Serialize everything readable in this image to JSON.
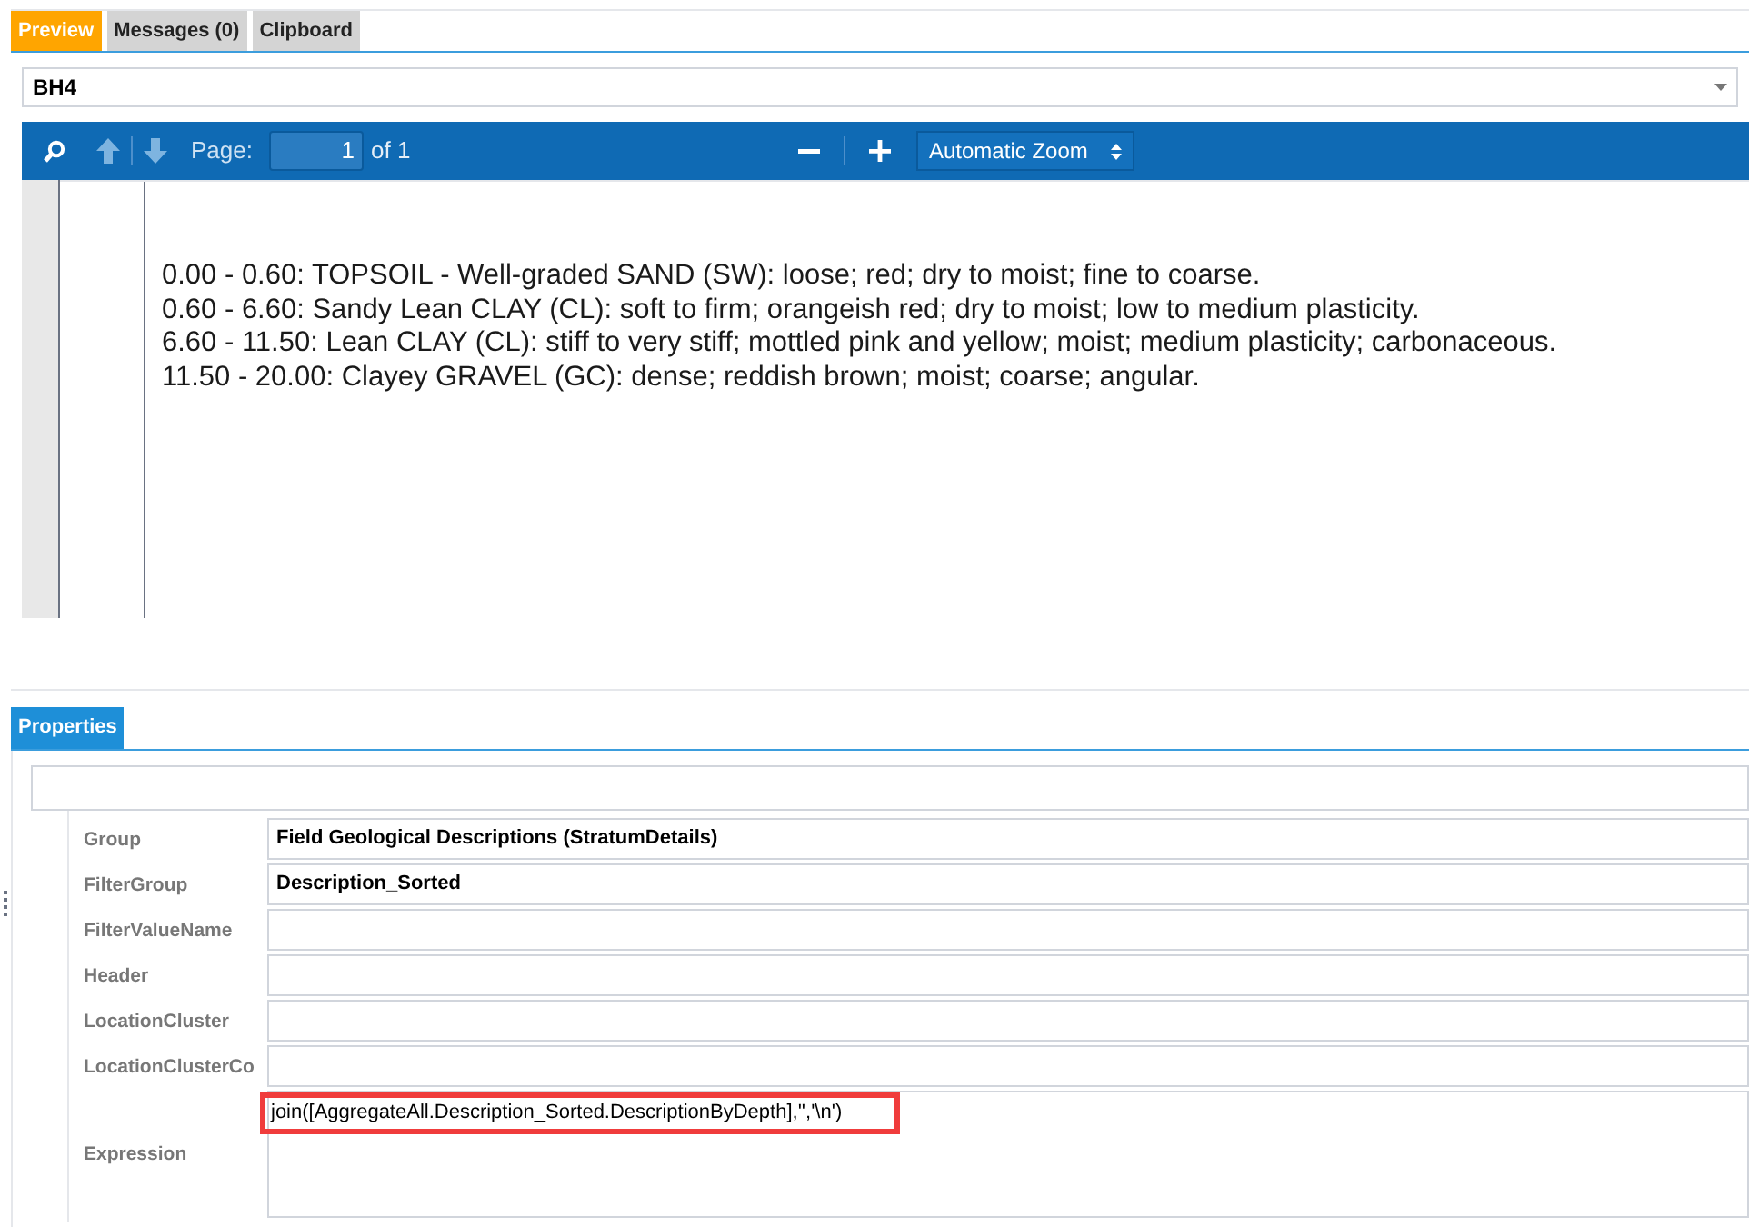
{
  "tabs": [
    {
      "label": "Preview",
      "selected": true
    },
    {
      "label": "Messages (0)",
      "selected": false
    },
    {
      "label": "Clipboard",
      "selected": false
    }
  ],
  "location_select": {
    "value": "BH4"
  },
  "viewer_toolbar": {
    "page_label": "Page:",
    "page_number": "1",
    "page_count": "of 1",
    "zoom": "Automatic Zoom"
  },
  "document_lines": [
    "0.00 - 0.60: TOPSOIL - Well-graded SAND (SW): loose; red; dry to moist; fine to coarse.",
    "0.60 - 6.60: Sandy Lean CLAY (CL): soft to firm; orangeish red; dry to moist; low to medium plasticity.",
    "6.60 - 11.50: Lean CLAY (CL): stiff to very stiff; mottled pink and yellow; moist; medium plasticity; carbonaceous.",
    "11.50 - 20.00: Clayey GRAVEL (GC): dense; reddish brown; moist; coarse; angular."
  ],
  "properties_tab": {
    "label": "Properties",
    "selected": true
  },
  "properties": [
    {
      "name": "Group",
      "value": "Field Geological Descriptions (StratumDetails)",
      "kind": "single",
      "highlighted": false
    },
    {
      "name": "FilterGroup",
      "value": "Description_Sorted",
      "kind": "single",
      "highlighted": false
    },
    {
      "name": "FilterValueName",
      "kind": "single",
      "highlighted": false
    },
    {
      "name": "Header",
      "kind": "single",
      "highlighted": false
    },
    {
      "name": "LocationCluster",
      "kind": "single",
      "highlighted": false
    },
    {
      "name": "LocationClusterCo",
      "kind": "single",
      "highlighted": false
    },
    {
      "name": "Expression",
      "value": "join([AggregateAll.Description_Sorted.DescriptionByDepth],'','\\n')",
      "kind": "multi",
      "highlighted": true
    }
  ]
}
